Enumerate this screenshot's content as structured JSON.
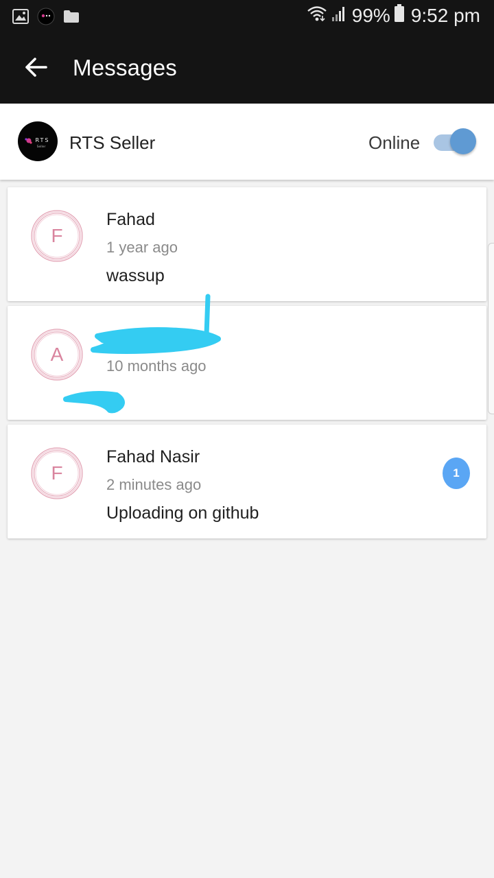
{
  "status_bar": {
    "battery": "99%",
    "time": "9:52 pm",
    "icons": [
      "image-icon",
      "app-logo-icon",
      "folder-icon",
      "wifi-icon",
      "signal-icon",
      "battery-icon"
    ]
  },
  "app_bar": {
    "title": "Messages",
    "back_icon": "back-arrow-icon"
  },
  "seller": {
    "name": "RTS Seller",
    "logo_text": "RTS",
    "logo_subtext": "Seller",
    "online_label": "Online",
    "online": true
  },
  "conversations": [
    {
      "initial": "F",
      "name": "Fahad",
      "time": "1 year ago",
      "last_message": "wassup",
      "unread": null
    },
    {
      "initial": "A",
      "name": "",
      "time": "10 months ago",
      "last_message": "",
      "unread": null
    },
    {
      "initial": "F",
      "name": "Fahad Nasir",
      "time": "2 minutes ago",
      "last_message": "Uploading on github",
      "unread": "1"
    }
  ],
  "colors": {
    "header_bg": "#141414",
    "page_bg": "#f3f3f3",
    "toggle_thumb": "#5f9ad3",
    "toggle_track": "#a9c5e3",
    "badge": "#5aa6f4",
    "avatar_ring": "#e2a1b3",
    "avatar_letter": "#d9849e",
    "scribble": "#34ccf2"
  }
}
